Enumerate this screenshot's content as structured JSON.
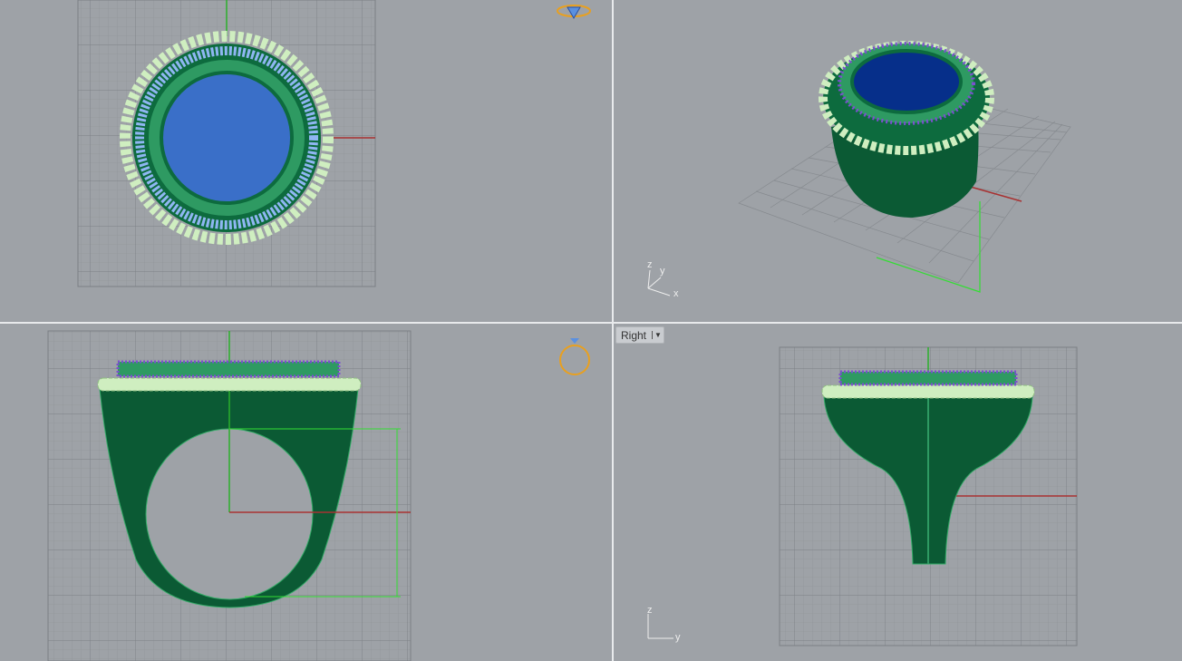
{
  "viewports": [
    {
      "name": "top",
      "label": ""
    },
    {
      "name": "perspective",
      "label": "",
      "axis_labels": {
        "z": "z",
        "y": "y",
        "x": "x"
      }
    },
    {
      "name": "front",
      "label": ""
    },
    {
      "name": "right",
      "label": "Right",
      "axis_labels": {
        "z": "z",
        "y": "y"
      }
    }
  ],
  "colors": {
    "background": "#9ea2a7",
    "grid": "#8a8e93",
    "x_axis": "#a83232",
    "y_axis": "#2bb02b",
    "ring_body": "#0d6b3e",
    "rope": "#cfeec0",
    "stones": "#7b4fd0",
    "center_stone_top": "#3a6fc8",
    "center_stone_persp": "#062f8a",
    "dimension": "#33dd33",
    "widget": "#e8a020"
  },
  "icons": {
    "top_widget": "ring-diamond-widget-icon",
    "front_widget": "ring-front-widget-icon"
  }
}
